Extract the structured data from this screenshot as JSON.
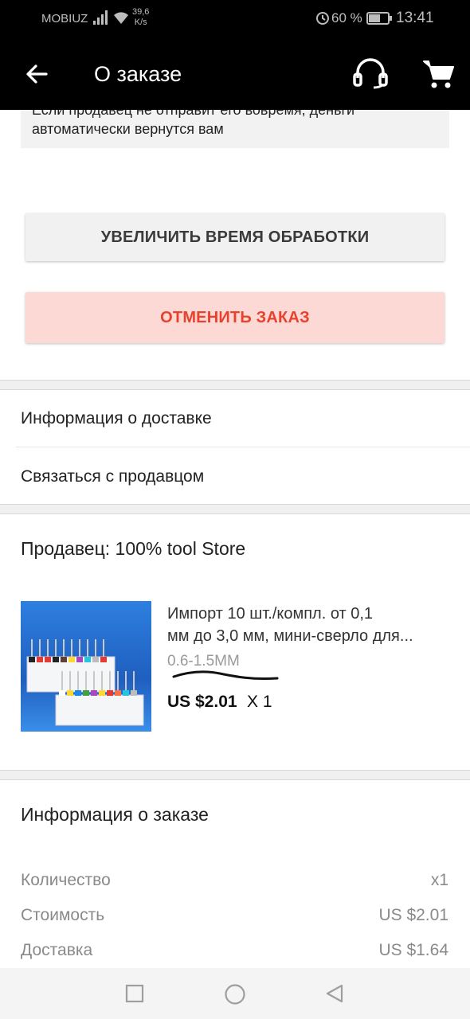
{
  "status_bar": {
    "carrier": "MOBIUZ",
    "speed_value": "39,6",
    "speed_unit": "K/s",
    "battery": "60 %",
    "time": "13:41"
  },
  "app_bar": {
    "title": "О заказе",
    "icons": [
      "back-arrow-icon",
      "headset-icon",
      "cart-icon"
    ]
  },
  "notice": {
    "line1": "Если продавец не отправит его вовремя, деньги",
    "line2": "автоматически вернутся вам"
  },
  "actions": {
    "extend_label": "УВЕЛИЧИТЬ ВРЕМЯ ОБРАБОТКИ",
    "cancel_label": "ОТМЕНИТЬ ЗАКАЗ"
  },
  "links": {
    "delivery_info": "Информация о доставке",
    "contact_seller": "Связаться с продавцом"
  },
  "seller": {
    "label": "Продавец: 100% tool Store"
  },
  "product": {
    "title_line1": "Импорт 10 шт./компл. от 0,1",
    "title_line2": "мм до 3,0 мм, мини-сверло для...",
    "variant": "0.6-1.5MM",
    "price": "US $2.01",
    "quantity": "X 1"
  },
  "order_info": {
    "title": "Информация о заказе",
    "rows": [
      {
        "label": "Количество",
        "value": "x1"
      },
      {
        "label": "Стоимость",
        "value": "US $2.01"
      },
      {
        "label": "Доставка",
        "value": "US $1.64"
      }
    ]
  },
  "colors": {
    "appbar": "#000000",
    "cancel_text": "#e8412c",
    "cancel_bg": "#fdd9d6",
    "extend_bg": "#f1f1f1"
  }
}
